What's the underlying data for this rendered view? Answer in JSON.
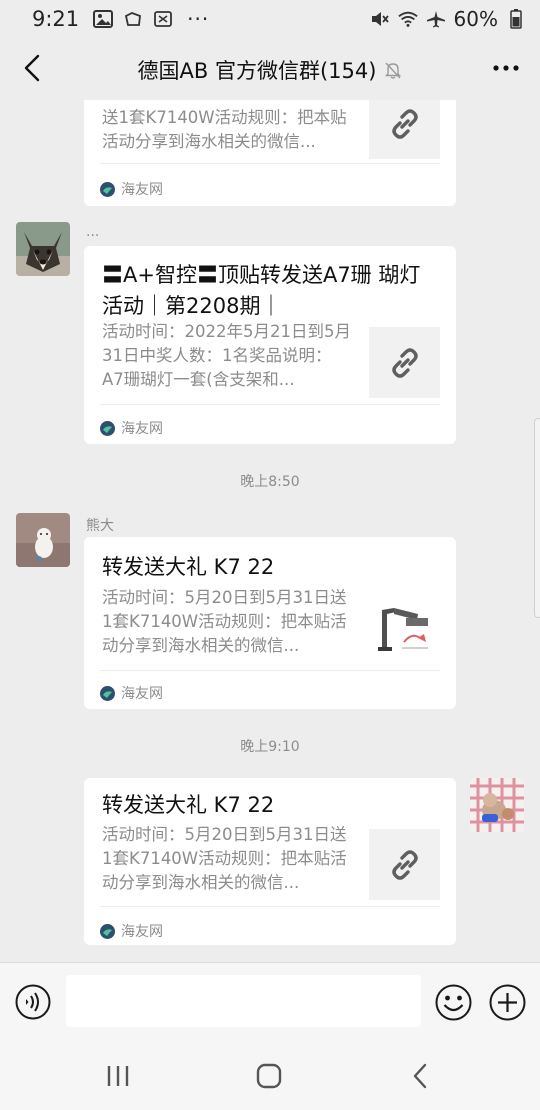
{
  "status_bar": {
    "time": "9:21",
    "battery": "60%",
    "icons": [
      "gallery-icon",
      "cloud-icon",
      "sim-icon",
      "more-dots-icon",
      "mute-icon",
      "wifi-icon",
      "airplane-icon",
      "battery-icon"
    ],
    "dots": "···"
  },
  "header": {
    "title": "德国AB  官方微信群(154)",
    "icons": [
      "back-icon",
      "bell-muted-icon",
      "more-icon"
    ]
  },
  "messages": [
    {
      "card": {
        "desc": "送1套K7140W活动规则：把本贴活动分享到海水相关的微信...",
        "source": "海友网"
      }
    },
    {
      "sender": "...",
      "card": {
        "title": "〓A+智控〓顶贴转发送A7珊 瑚灯活动｜第2208期｜",
        "desc": "活动时间：2022年5月21日到5月31日中奖人数：1名奖品说明：A7珊瑚灯一套(含支架和...",
        "source": "海友网"
      }
    },
    {
      "timestamp": "晚上8:50",
      "sender": "熊大",
      "card": {
        "title": "转发送大礼 K7 22",
        "desc": "活动时间：5月20日到5月31日送1套K7140W活动规则：把本贴活动分享到海水相关的微信...",
        "source": "海友网"
      }
    },
    {
      "timestamp": "晚上9:10",
      "card": {
        "title": "转发送大礼 K7 22",
        "desc": "活动时间：5月20日到5月31日送1套K7140W活动规则：把本贴活动分享到海水相关的微信...",
        "source": "海友网"
      }
    }
  ],
  "input_bar": {
    "value": "",
    "icons": [
      "voice-icon",
      "emoji-icon",
      "plus-icon"
    ]
  },
  "nav_bar": {
    "icons": [
      "recents-icon",
      "home-icon",
      "back-nav-icon"
    ]
  },
  "colors": {
    "background": "#ededed",
    "bubble": "#ffffff",
    "muted_text": "#8c8c8c",
    "link_icon": "#5f5f5f"
  }
}
